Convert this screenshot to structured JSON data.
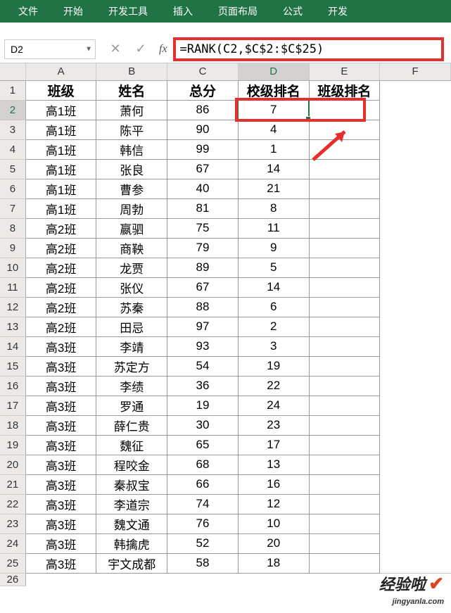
{
  "ribbon": {
    "tabs": [
      "文件",
      "开始",
      "开发工具",
      "插入",
      "页面布局",
      "公式",
      "开发"
    ]
  },
  "name_box": "D2",
  "formula": "=RANK(C2,$C$2:$C$25)",
  "columns": [
    "A",
    "B",
    "C",
    "D",
    "E",
    "F"
  ],
  "headers": {
    "A": "班级",
    "B": "姓名",
    "C": "总分",
    "D": "校级排名",
    "E": "班级排名"
  },
  "rows": [
    {
      "r": 2,
      "A": "高1班",
      "B": "萧何",
      "C": 86,
      "D": 7,
      "E": ""
    },
    {
      "r": 3,
      "A": "高1班",
      "B": "陈平",
      "C": 90,
      "D": 4,
      "E": ""
    },
    {
      "r": 4,
      "A": "高1班",
      "B": "韩信",
      "C": 99,
      "D": 1,
      "E": ""
    },
    {
      "r": 5,
      "A": "高1班",
      "B": "张良",
      "C": 67,
      "D": 14,
      "E": ""
    },
    {
      "r": 6,
      "A": "高1班",
      "B": "曹参",
      "C": 40,
      "D": 21,
      "E": ""
    },
    {
      "r": 7,
      "A": "高1班",
      "B": "周勃",
      "C": 81,
      "D": 8,
      "E": ""
    },
    {
      "r": 8,
      "A": "高2班",
      "B": "嬴驷",
      "C": 75,
      "D": 11,
      "E": ""
    },
    {
      "r": 9,
      "A": "高2班",
      "B": "商鞅",
      "C": 79,
      "D": 9,
      "E": ""
    },
    {
      "r": 10,
      "A": "高2班",
      "B": "龙贾",
      "C": 89,
      "D": 5,
      "E": ""
    },
    {
      "r": 11,
      "A": "高2班",
      "B": "张仪",
      "C": 67,
      "D": 14,
      "E": ""
    },
    {
      "r": 12,
      "A": "高2班",
      "B": "苏秦",
      "C": 88,
      "D": 6,
      "E": ""
    },
    {
      "r": 13,
      "A": "高2班",
      "B": "田忌",
      "C": 97,
      "D": 2,
      "E": ""
    },
    {
      "r": 14,
      "A": "高3班",
      "B": "李靖",
      "C": 93,
      "D": 3,
      "E": ""
    },
    {
      "r": 15,
      "A": "高3班",
      "B": "苏定方",
      "C": 54,
      "D": 19,
      "E": ""
    },
    {
      "r": 16,
      "A": "高3班",
      "B": "李绩",
      "C": 36,
      "D": 22,
      "E": ""
    },
    {
      "r": 17,
      "A": "高3班",
      "B": "罗通",
      "C": 19,
      "D": 24,
      "E": ""
    },
    {
      "r": 18,
      "A": "高3班",
      "B": "薛仁贵",
      "C": 30,
      "D": 23,
      "E": ""
    },
    {
      "r": 19,
      "A": "高3班",
      "B": "魏征",
      "C": 65,
      "D": 17,
      "E": ""
    },
    {
      "r": 20,
      "A": "高3班",
      "B": "程咬金",
      "C": 68,
      "D": 13,
      "E": ""
    },
    {
      "r": 21,
      "A": "高3班",
      "B": "秦叔宝",
      "C": 66,
      "D": 16,
      "E": ""
    },
    {
      "r": 22,
      "A": "高3班",
      "B": "李道宗",
      "C": 74,
      "D": 12,
      "E": ""
    },
    {
      "r": 23,
      "A": "高3班",
      "B": "魏文通",
      "C": 76,
      "D": 10,
      "E": ""
    },
    {
      "r": 24,
      "A": "高3班",
      "B": "韩擒虎",
      "C": 52,
      "D": 20,
      "E": ""
    },
    {
      "r": 25,
      "A": "高3班",
      "B": "宇文成都",
      "C": 58,
      "D": 18,
      "E": ""
    }
  ],
  "watermark": {
    "main": "经验啦",
    "sub": "jingyanla.com"
  },
  "chart_data": {
    "type": "table",
    "title": "",
    "columns": [
      "班级",
      "姓名",
      "总分",
      "校级排名",
      "班级排名"
    ],
    "data": [
      [
        "高1班",
        "萧何",
        86,
        7,
        null
      ],
      [
        "高1班",
        "陈平",
        90,
        4,
        null
      ],
      [
        "高1班",
        "韩信",
        99,
        1,
        null
      ],
      [
        "高1班",
        "张良",
        67,
        14,
        null
      ],
      [
        "高1班",
        "曹参",
        40,
        21,
        null
      ],
      [
        "高1班",
        "周勃",
        81,
        8,
        null
      ],
      [
        "高2班",
        "嬴驷",
        75,
        11,
        null
      ],
      [
        "高2班",
        "商鞅",
        79,
        9,
        null
      ],
      [
        "高2班",
        "龙贾",
        89,
        5,
        null
      ],
      [
        "高2班",
        "张仪",
        67,
        14,
        null
      ],
      [
        "高2班",
        "苏秦",
        88,
        6,
        null
      ],
      [
        "高2班",
        "田忌",
        97,
        2,
        null
      ],
      [
        "高3班",
        "李靖",
        93,
        3,
        null
      ],
      [
        "高3班",
        "苏定方",
        54,
        19,
        null
      ],
      [
        "高3班",
        "李绩",
        36,
        22,
        null
      ],
      [
        "高3班",
        "罗通",
        19,
        24,
        null
      ],
      [
        "高3班",
        "薛仁贵",
        30,
        23,
        null
      ],
      [
        "高3班",
        "魏征",
        65,
        17,
        null
      ],
      [
        "高3班",
        "程咬金",
        68,
        13,
        null
      ],
      [
        "高3班",
        "秦叔宝",
        66,
        16,
        null
      ],
      [
        "高3班",
        "李道宗",
        74,
        12,
        null
      ],
      [
        "高3班",
        "魏文通",
        76,
        10,
        null
      ],
      [
        "高3班",
        "韩擒虎",
        52,
        20,
        null
      ],
      [
        "高3班",
        "宇文成都",
        58,
        18,
        null
      ]
    ],
    "formula_D": "=RANK(C2,$C$2:$C$25)"
  }
}
